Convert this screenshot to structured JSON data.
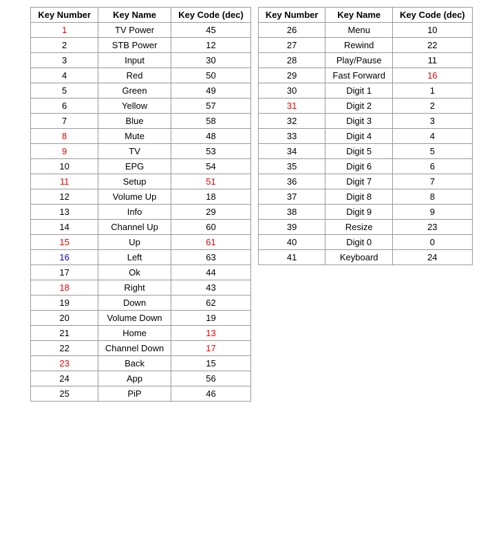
{
  "table1": {
    "headers": [
      "Key Number",
      "Key Name",
      "Key Code (dec)"
    ],
    "rows": [
      {
        "num": "1",
        "name": "TV Power",
        "code": "45",
        "numColor": "red",
        "codeColor": ""
      },
      {
        "num": "2",
        "name": "STB Power",
        "code": "12",
        "numColor": "",
        "codeColor": ""
      },
      {
        "num": "3",
        "name": "Input",
        "code": "30",
        "numColor": "",
        "codeColor": ""
      },
      {
        "num": "4",
        "name": "Red",
        "code": "50",
        "numColor": "",
        "codeColor": ""
      },
      {
        "num": "5",
        "name": "Green",
        "code": "49",
        "numColor": "",
        "codeColor": ""
      },
      {
        "num": "6",
        "name": "Yellow",
        "code": "57",
        "numColor": "",
        "codeColor": ""
      },
      {
        "num": "7",
        "name": "Blue",
        "code": "58",
        "numColor": "",
        "codeColor": ""
      },
      {
        "num": "8",
        "name": "Mute",
        "code": "48",
        "numColor": "red",
        "codeColor": ""
      },
      {
        "num": "9",
        "name": "TV",
        "code": "53",
        "numColor": "red",
        "codeColor": ""
      },
      {
        "num": "10",
        "name": "EPG",
        "code": "54",
        "numColor": "",
        "codeColor": ""
      },
      {
        "num": "11",
        "name": "Setup",
        "code": "51",
        "numColor": "red",
        "codeColor": "red"
      },
      {
        "num": "12",
        "name": "Volume Up",
        "code": "18",
        "numColor": "",
        "codeColor": ""
      },
      {
        "num": "13",
        "name": "Info",
        "code": "29",
        "numColor": "",
        "codeColor": ""
      },
      {
        "num": "14",
        "name": "Channel Up",
        "code": "60",
        "numColor": "",
        "codeColor": ""
      },
      {
        "num": "15",
        "name": "Up",
        "code": "61",
        "numColor": "red",
        "codeColor": "red"
      },
      {
        "num": "16",
        "name": "Left",
        "code": "63",
        "numColor": "blue",
        "codeColor": ""
      },
      {
        "num": "17",
        "name": "Ok",
        "code": "44",
        "numColor": "",
        "codeColor": ""
      },
      {
        "num": "18",
        "name": "Right",
        "code": "43",
        "numColor": "red",
        "codeColor": ""
      },
      {
        "num": "19",
        "name": "Down",
        "code": "62",
        "numColor": "",
        "codeColor": ""
      },
      {
        "num": "20",
        "name": "Volume Down",
        "code": "19",
        "numColor": "",
        "codeColor": ""
      },
      {
        "num": "21",
        "name": "Home",
        "code": "13",
        "numColor": "",
        "codeColor": "red"
      },
      {
        "num": "22",
        "name": "Channel Down",
        "code": "17",
        "numColor": "",
        "codeColor": "red"
      },
      {
        "num": "23",
        "name": "Back",
        "code": "15",
        "numColor": "red",
        "codeColor": ""
      },
      {
        "num": "24",
        "name": "App",
        "code": "56",
        "numColor": "",
        "codeColor": ""
      },
      {
        "num": "25",
        "name": "PiP",
        "code": "46",
        "numColor": "",
        "codeColor": ""
      }
    ]
  },
  "table2": {
    "headers": [
      "Key Number",
      "Key Name",
      "Key Code (dec)"
    ],
    "rows": [
      {
        "num": "26",
        "name": "Menu",
        "code": "10",
        "numColor": "",
        "codeColor": ""
      },
      {
        "num": "27",
        "name": "Rewind",
        "code": "22",
        "numColor": "",
        "codeColor": ""
      },
      {
        "num": "28",
        "name": "Play/Pause",
        "code": "11",
        "numColor": "",
        "codeColor": ""
      },
      {
        "num": "29",
        "name": "Fast Forward",
        "code": "16",
        "numColor": "",
        "codeColor": "red"
      },
      {
        "num": "30",
        "name": "Digit 1",
        "code": "1",
        "numColor": "",
        "codeColor": ""
      },
      {
        "num": "31",
        "name": "Digit 2",
        "code": "2",
        "numColor": "red",
        "codeColor": ""
      },
      {
        "num": "32",
        "name": "Digit 3",
        "code": "3",
        "numColor": "",
        "codeColor": ""
      },
      {
        "num": "33",
        "name": "Digit 4",
        "code": "4",
        "numColor": "",
        "codeColor": ""
      },
      {
        "num": "34",
        "name": "Digit 5",
        "code": "5",
        "numColor": "",
        "codeColor": ""
      },
      {
        "num": "35",
        "name": "Digit 6",
        "code": "6",
        "numColor": "",
        "codeColor": ""
      },
      {
        "num": "36",
        "name": "Digit 7",
        "code": "7",
        "numColor": "",
        "codeColor": ""
      },
      {
        "num": "37",
        "name": "Digit 8",
        "code": "8",
        "numColor": "",
        "codeColor": ""
      },
      {
        "num": "38",
        "name": "Digit 9",
        "code": "9",
        "numColor": "",
        "codeColor": ""
      },
      {
        "num": "39",
        "name": "Resize",
        "code": "23",
        "numColor": "",
        "codeColor": ""
      },
      {
        "num": "40",
        "name": "Digit 0",
        "code": "0",
        "numColor": "",
        "codeColor": ""
      },
      {
        "num": "41",
        "name": "Keyboard",
        "code": "24",
        "numColor": "",
        "codeColor": ""
      }
    ]
  }
}
